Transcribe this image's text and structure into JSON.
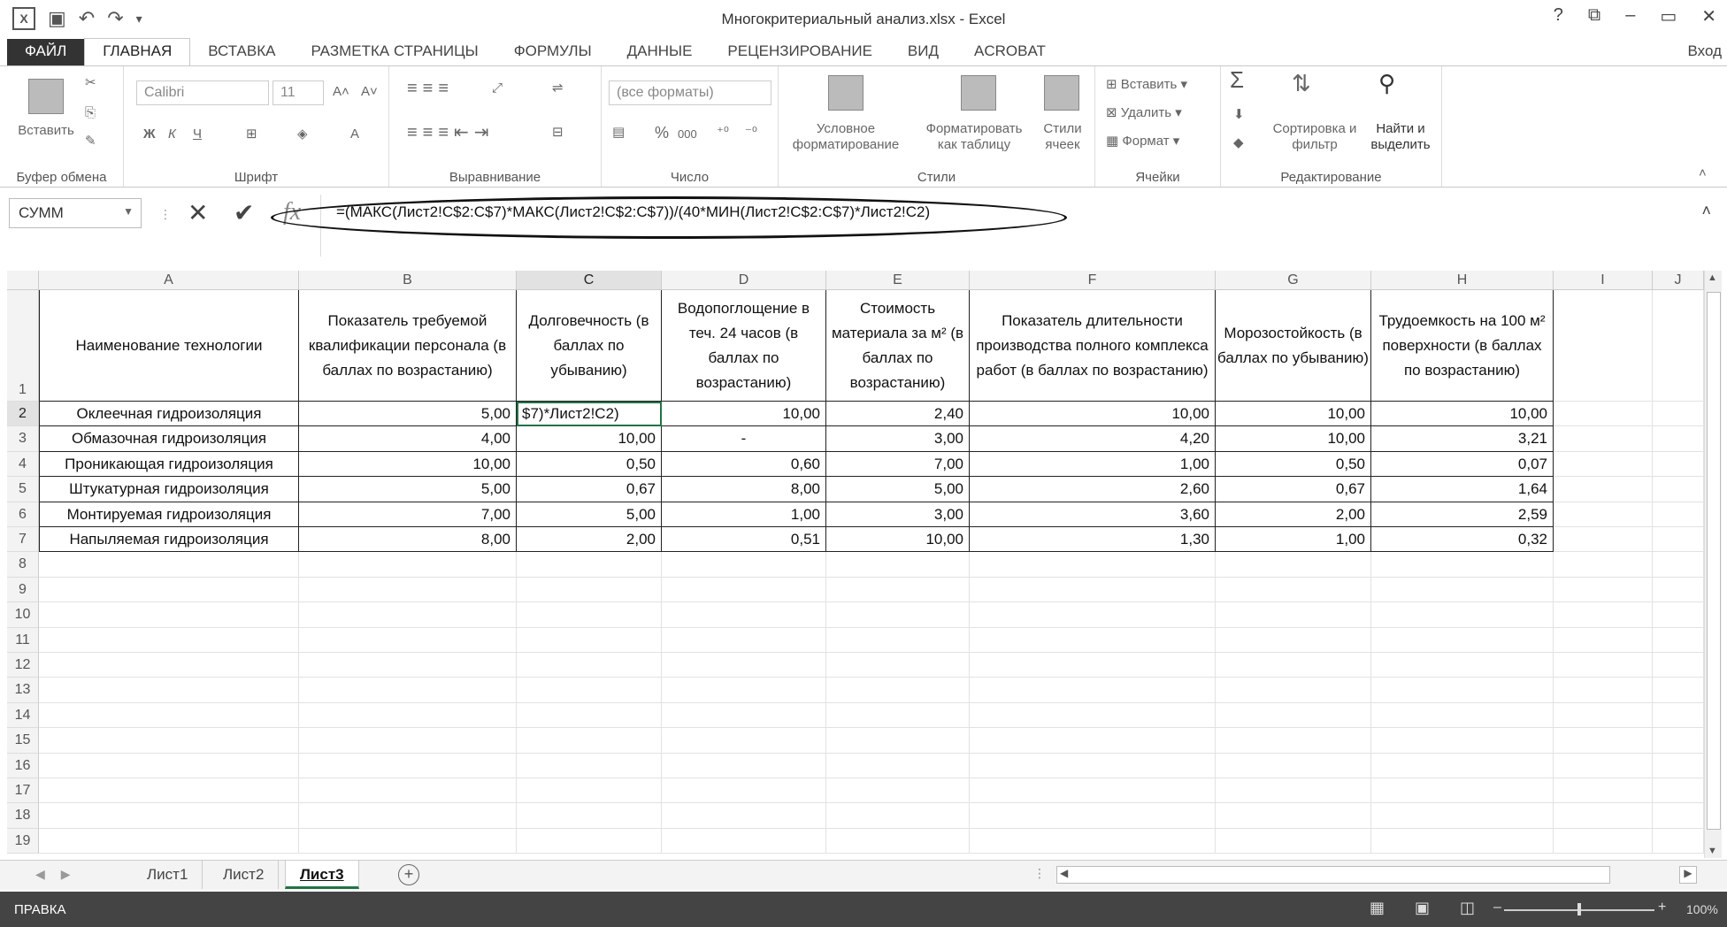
{
  "window": {
    "title": "Многокритериальный анализ.xlsx - Excel",
    "help": "?",
    "controls": [
      "⧉",
      "–",
      "▭",
      "✕"
    ]
  },
  "qat": {
    "logo": "X",
    "save": "💾",
    "undo": "↶",
    "redo": "↷",
    "customize": "⇵"
  },
  "tabs": [
    "ФАЙЛ",
    "ГЛАВНАЯ",
    "ВСТАВКА",
    "РАЗМЕТКА СТРАНИЦЫ",
    "ФОРМУЛЫ",
    "ДАННЫЕ",
    "РЕЦЕНЗИРОВАНИЕ",
    "ВИД",
    "ACROBAT"
  ],
  "active_tab": "ГЛАВНАЯ",
  "signin": "Вход",
  "ribbon": {
    "clipboard": {
      "paste": "Вставить",
      "label": "Буфер обмена"
    },
    "font": {
      "name": "Calibri",
      "size": "11",
      "bold": "Ж",
      "italic": "К",
      "underline": "Ч",
      "grow": "A˄",
      "shrink": "A˅",
      "color": "A",
      "label": "Шрифт"
    },
    "alignment": {
      "label": "Выравнивание"
    },
    "number": {
      "format": "(все форматы)",
      "percent": "%",
      "thousands": "000",
      "label": "Число"
    },
    "styles": {
      "conditional": "Условное форматирование",
      "as_table": "Форматировать как таблицу",
      "cell_styles": "Стили ячеек",
      "label": "Стили"
    },
    "cells": {
      "insert": "Вставить",
      "delete": "Удалить",
      "format": "Формат",
      "label": "Ячейки"
    },
    "editing": {
      "sum": "Σ",
      "sort": "Сортировка и фильтр",
      "find": "Найти и выделить",
      "label": "Редактирование"
    }
  },
  "formula_bar": {
    "name_box": "СУММ",
    "cancel": "✕",
    "enter": "✔",
    "fx": "fx",
    "formula": "=(МАКС(Лист2!C$2:C$7)*МАКС(Лист2!C$2:C$7))/(40*МИН(Лист2!C$2:C$7)*Лист2!C2)"
  },
  "grid": {
    "columns": [
      "A",
      "B",
      "C",
      "D",
      "E",
      "F",
      "G",
      "H",
      "I",
      "J"
    ],
    "selected_column": "C",
    "selected_row": "2",
    "header_row": [
      "Наименование технологии",
      "Показатель требуемой квалификации персонала (в баллах по возрастанию)",
      "Долговечность (в баллах по убыванию)",
      "Водопоглощение в теч. 24 часов (в баллах по возрастанию)",
      "Стоимость материала за м² (в баллах по возрастанию)",
      "Показатель длительности производства полного комплекса работ (в баллах по возрастанию)",
      "Морозостойкость (в баллах по убыванию)",
      "Трудоемкость на 100 м² поверхности (в баллах по возрастанию)"
    ],
    "rows": [
      [
        "Оклеечная гидроизоляция",
        "5,00",
        "$7)*Лист2!C2)",
        "10,00",
        "2,40",
        "10,00",
        "10,00",
        "10,00"
      ],
      [
        "Обмазочная гидроизоляция",
        "4,00",
        "10,00",
        "-",
        "3,00",
        "4,20",
        "10,00",
        "3,21"
      ],
      [
        "Проникающая гидроизоляция",
        "10,00",
        "0,50",
        "0,60",
        "7,00",
        "1,00",
        "0,50",
        "0,07"
      ],
      [
        "Штукатурная гидроизоляция",
        "5,00",
        "0,67",
        "8,00",
        "5,00",
        "2,60",
        "0,67",
        "1,64"
      ],
      [
        "Монтируемая гидроизоляция",
        "7,00",
        "5,00",
        "1,00",
        "3,00",
        "3,60",
        "2,00",
        "2,59"
      ],
      [
        "Напыляемая гидроизоляция",
        "8,00",
        "2,00",
        "0,51",
        "10,00",
        "1,30",
        "1,00",
        "0,32"
      ]
    ],
    "row_numbers": [
      "1",
      "2",
      "3",
      "4",
      "5",
      "6",
      "7",
      "8",
      "9",
      "10",
      "11",
      "12",
      "13",
      "14",
      "15",
      "16",
      "17",
      "18",
      "19"
    ]
  },
  "sheets": [
    "Лист1",
    "Лист2",
    "Лист3"
  ],
  "active_sheet": "Лист3",
  "add_sheet": "+",
  "status": {
    "mode": "ПРАВКА",
    "zoom": "100%"
  }
}
